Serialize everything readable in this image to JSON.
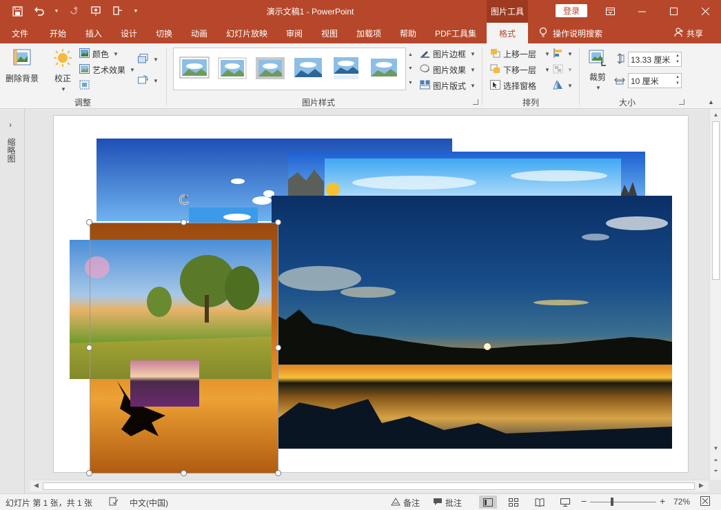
{
  "titlebar": {
    "doc_title": "演示文稿1  -  PowerPoint",
    "contextual_header": "图片工具",
    "signin": "登录"
  },
  "tabs": [
    "文件",
    "开始",
    "插入",
    "设计",
    "切换",
    "动画",
    "幻灯片放映",
    "审阅",
    "视图",
    "加载项",
    "帮助",
    "PDF工具集",
    "格式"
  ],
  "active_tab": "格式",
  "tellme": "操作说明搜索",
  "share": "共享",
  "ribbon": {
    "adjust": {
      "remove_bg": "删除背景",
      "correct": "校正",
      "color": "颜色",
      "artistic": "艺术效果",
      "label": "调整"
    },
    "picture_styles": {
      "border": "图片边框",
      "effects": "图片效果",
      "layout": "图片版式",
      "label": "图片样式"
    },
    "arrange": {
      "bring_forward": "上移一层",
      "send_backward": "下移一层",
      "selection_pane": "选择窗格",
      "label": "排列"
    },
    "size": {
      "crop": "裁剪",
      "height": "13.33 厘米",
      "width": "10 厘米",
      "label": "大小"
    }
  },
  "left_pane": {
    "label": "缩略图"
  },
  "status": {
    "slide_info": "幻灯片 第 1 张，共 1 张",
    "language": "中文(中国)",
    "notes": "备注",
    "comments": "批注",
    "zoom_percent": "72%",
    "zoom_value": 72
  },
  "colors": {
    "accent": "#b7472a",
    "ribbon_bg": "#f3f3f3",
    "canvas_bg": "#e6e6e6"
  }
}
